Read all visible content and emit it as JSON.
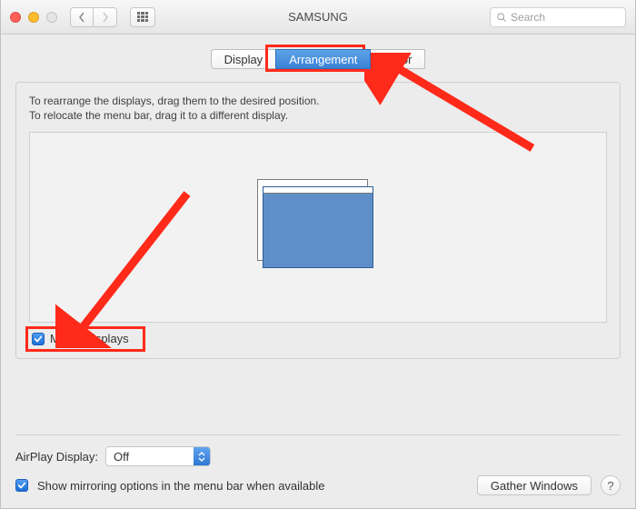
{
  "window": {
    "title": "SAMSUNG",
    "search_placeholder": "Search"
  },
  "tabs": {
    "display": "Display",
    "arrangement": "Arrangement",
    "color": "Color"
  },
  "panel": {
    "instruction_line1": "To rearrange the displays, drag them to the desired position.",
    "instruction_line2": "To relocate the menu bar, drag it to a different display.",
    "mirror_label": "Mirror Displays",
    "mirror_checked": true
  },
  "bottom": {
    "airplay_label": "AirPlay Display:",
    "airplay_value": "Off",
    "show_mirroring_label": "Show mirroring options in the menu bar when available",
    "show_mirroring_checked": true,
    "gather_label": "Gather Windows",
    "help_label": "?"
  },
  "icons": {
    "back": "‹",
    "forward": "›"
  }
}
